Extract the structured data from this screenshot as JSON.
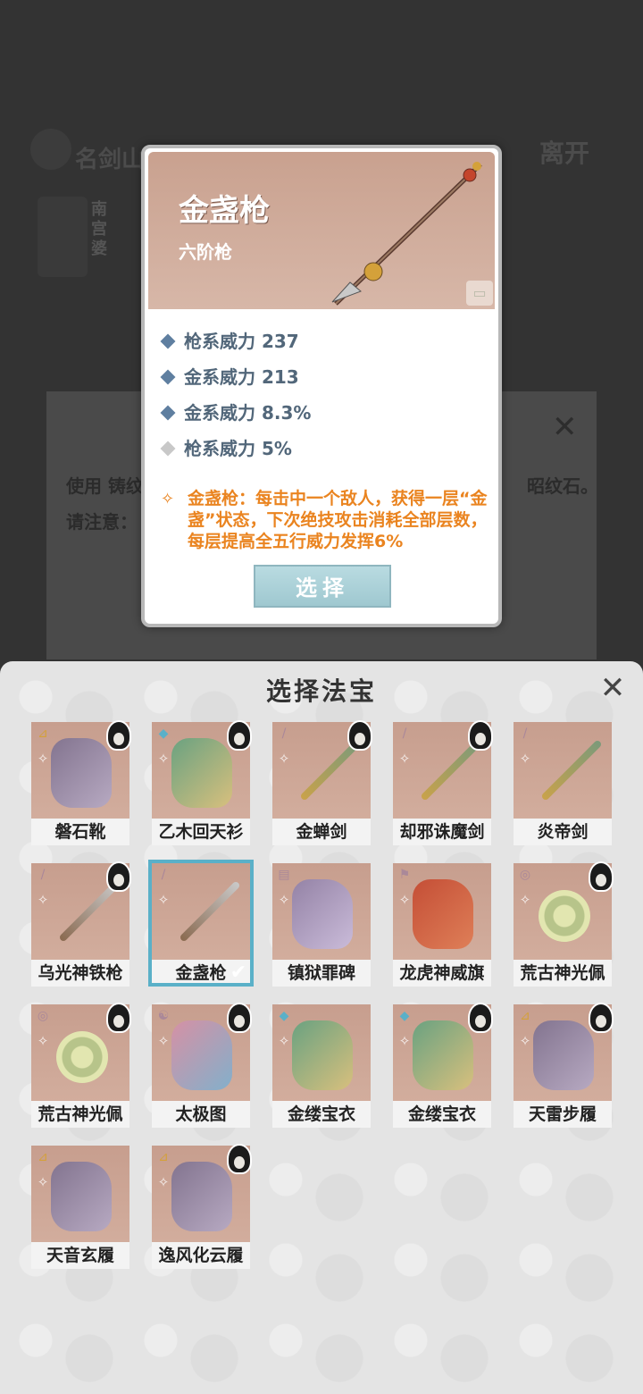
{
  "background": {
    "title": "名剑山",
    "leave": "离开",
    "npc_name": "南宫婆",
    "dialog_text1": "使用 铸纹",
    "dialog_text1_end": "昭纹石。",
    "dialog_text2": "请注意：",
    "close": "✕"
  },
  "panel": {
    "title": "选择法宝",
    "close_icon": "close-icon",
    "items": [
      {
        "name": "磐石靴",
        "type": "boots",
        "has_char": true
      },
      {
        "name": "乙木回天衫",
        "type": "armor",
        "has_char": true
      },
      {
        "name": "金蝉剑",
        "type": "sword",
        "has_char": true
      },
      {
        "name": "却邪诛魔剑",
        "type": "sword",
        "has_char": true
      },
      {
        "name": "炎帝剑",
        "type": "sword",
        "has_char": false
      },
      {
        "name": "乌光神铁枪",
        "type": "spear",
        "has_char": true
      },
      {
        "name": "金盏枪",
        "type": "spear",
        "has_char": false,
        "selected": true
      },
      {
        "name": "镇狱罪碑",
        "type": "tablet",
        "has_char": false
      },
      {
        "name": "龙虎神威旗",
        "type": "flag",
        "has_char": false
      },
      {
        "name": "荒古神光佩",
        "type": "pendant",
        "has_char": true
      },
      {
        "name": "荒古神光佩",
        "type": "pendant",
        "has_char": true
      },
      {
        "name": "太极图",
        "type": "scroll",
        "has_char": true
      },
      {
        "name": "金缕宝衣",
        "type": "armor",
        "has_char": false
      },
      {
        "name": "金缕宝衣",
        "type": "armor",
        "has_char": true
      },
      {
        "name": "天雷步履",
        "type": "boots",
        "has_char": true
      },
      {
        "name": "天音玄履",
        "type": "boots",
        "has_char": false
      },
      {
        "name": "逸风化云履",
        "type": "boots",
        "has_char": true
      }
    ]
  },
  "popup": {
    "title": "金盏枪",
    "subtitle": "六阶枪",
    "stats": [
      {
        "text": "枪系威力 237",
        "dim": false
      },
      {
        "text": "金系威力 213",
        "dim": false
      },
      {
        "text": "金系威力 8.3%",
        "dim": false
      },
      {
        "text": "枪系威力 5%",
        "dim": true
      }
    ],
    "effect": "金盏枪：每击中一个敌人，获得一层“金盏”状态，下次绝技攻击消耗全部层数，每层提高全五行威力发挥6%",
    "select_label": "选择"
  },
  "colors": {
    "accent": "#5ab0c8",
    "effect": "#ea8420",
    "stat": "#52677a",
    "item_bg": "#c79e8e"
  }
}
